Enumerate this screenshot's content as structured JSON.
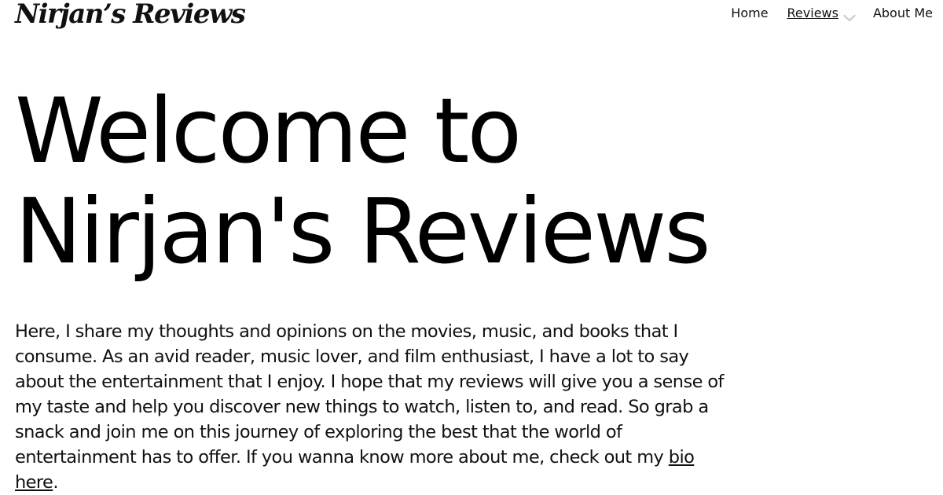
{
  "header": {
    "logo_text": "Nirjan’s Reviews",
    "nav": {
      "home": "Home",
      "reviews": "Reviews",
      "about": "About Me"
    }
  },
  "hero": {
    "title_line1": "Welcome to",
    "title_line2": "Nirjan's Reviews"
  },
  "intro": {
    "text": "Here, I share my thoughts and opinions on the movies, music, and books that I consume. As an avid reader, music lover, and film enthusiast, I have a lot to say about the entertainment that I enjoy. I hope that my reviews will give you a sense of my taste and help you discover new things to watch, listen to, and read. So grab a snack and join me on this journey of exploring the best that the world of entertainment has to offer. If you wanna know more about me, check out my ",
    "bio_link": "bio here",
    "end": "."
  },
  "icons": {
    "dropdown": "chevron-down-icon"
  }
}
